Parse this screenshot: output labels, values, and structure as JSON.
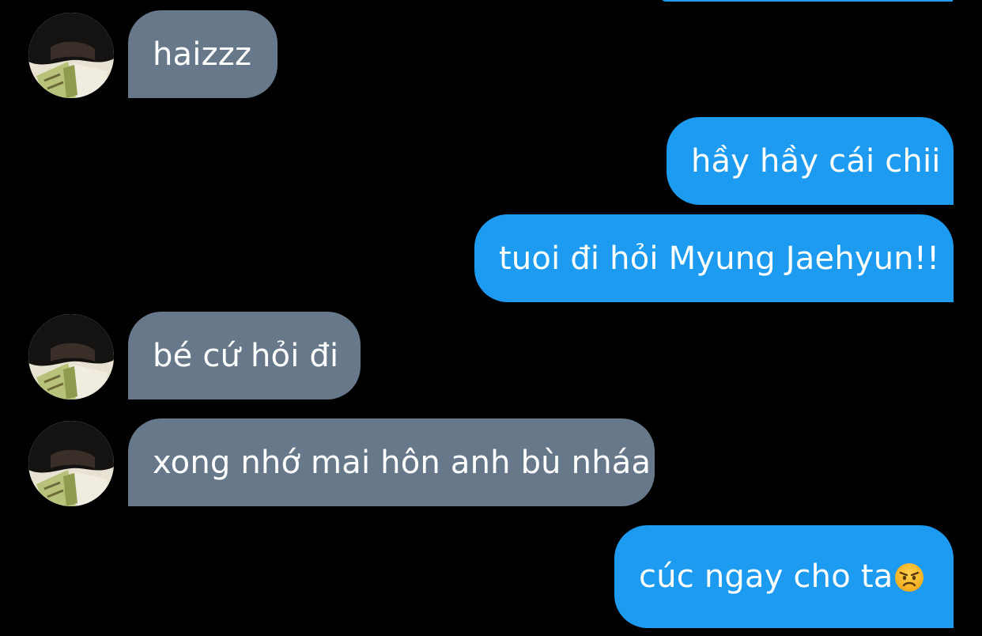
{
  "conversation": {
    "messages": [
      {
        "direction": "incoming",
        "text": "haizzz"
      },
      {
        "direction": "outgoing",
        "text": "hầy hầy cái chii"
      },
      {
        "direction": "outgoing",
        "text": "tuoi đi hỏi Myung Jaehyun!!"
      },
      {
        "direction": "incoming",
        "text": "bé cứ hỏi đi"
      },
      {
        "direction": "incoming",
        "text": "xong nhớ mai hôn anh bù nháa"
      },
      {
        "direction": "outgoing",
        "text": "cúc ngay cho ta",
        "emoji": "angry-face-emoji"
      }
    ]
  },
  "colors": {
    "background": "#000000",
    "incoming_bubble": "#66788a",
    "outgoing_bubble": "#1d9bf0",
    "text": "#ffffff"
  }
}
